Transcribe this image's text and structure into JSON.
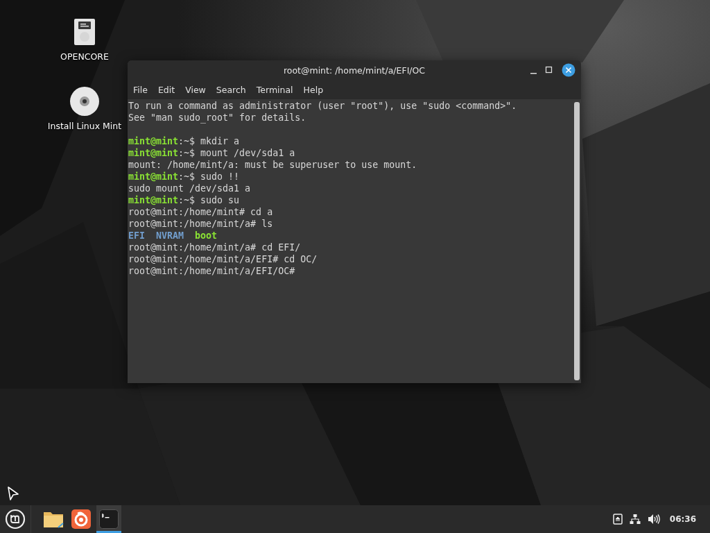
{
  "desktop": {
    "icons": [
      {
        "label": "OPENCORE",
        "kind": "drive"
      },
      {
        "label": "Install Linux Mint",
        "kind": "disc"
      }
    ]
  },
  "terminal": {
    "title": "root@mint: /home/mint/a/EFI/OC",
    "menu": [
      "File",
      "Edit",
      "View",
      "Search",
      "Terminal",
      "Help"
    ],
    "lines": [
      {
        "kind": "output",
        "segments": [
          {
            "kind": "text",
            "text": "To run a command as administrator (user \"root\"), use \"sudo <command>\"."
          }
        ]
      },
      {
        "kind": "output",
        "segments": [
          {
            "kind": "text",
            "text": "See \"man sudo_root\" for details."
          }
        ]
      },
      {
        "kind": "blank"
      },
      {
        "kind": "output",
        "segments": [
          {
            "kind": "prompt",
            "text": "mint@mint"
          },
          {
            "kind": "text",
            "text": ":~$ mkdir a"
          }
        ]
      },
      {
        "kind": "output",
        "segments": [
          {
            "kind": "prompt",
            "text": "mint@mint"
          },
          {
            "kind": "text",
            "text": ":~$ mount /dev/sda1 a"
          }
        ]
      },
      {
        "kind": "output",
        "segments": [
          {
            "kind": "text",
            "text": "mount: /home/mint/a: must be superuser to use mount."
          }
        ]
      },
      {
        "kind": "output",
        "segments": [
          {
            "kind": "prompt",
            "text": "mint@mint"
          },
          {
            "kind": "text",
            "text": ":~$ sudo !!"
          }
        ]
      },
      {
        "kind": "output",
        "segments": [
          {
            "kind": "text",
            "text": "sudo mount /dev/sda1 a"
          }
        ]
      },
      {
        "kind": "output",
        "segments": [
          {
            "kind": "prompt",
            "text": "mint@mint"
          },
          {
            "kind": "text",
            "text": ":~$ sudo su"
          }
        ]
      },
      {
        "kind": "output",
        "segments": [
          {
            "kind": "text",
            "text": "root@mint:/home/mint# cd a"
          }
        ]
      },
      {
        "kind": "output",
        "segments": [
          {
            "kind": "text",
            "text": "root@mint:/home/mint/a# ls"
          }
        ]
      },
      {
        "kind": "listing",
        "items": [
          {
            "kind": "dir",
            "text": "EFI"
          },
          {
            "kind": "dir",
            "text": "NVRAM"
          },
          {
            "kind": "writable",
            "text": "boot"
          }
        ]
      },
      {
        "kind": "output",
        "segments": [
          {
            "kind": "text",
            "text": "root@mint:/home/mint/a# cd EFI/"
          }
        ]
      },
      {
        "kind": "output",
        "segments": [
          {
            "kind": "text",
            "text": "root@mint:/home/mint/a/EFI# cd OC/"
          }
        ]
      },
      {
        "kind": "output",
        "segments": [
          {
            "kind": "text",
            "text": "root@mint:/home/mint/a/EFI/OC#"
          }
        ]
      }
    ]
  },
  "taskbar": {
    "apps": [
      {
        "kind": "files",
        "selected": false
      },
      {
        "kind": "browser",
        "selected": false
      },
      {
        "kind": "terminal",
        "selected": true
      }
    ],
    "clock": "06:36"
  }
}
